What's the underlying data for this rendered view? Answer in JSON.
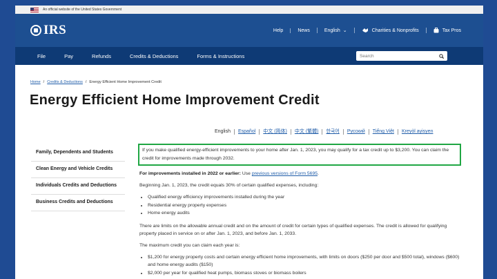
{
  "gov_banner": {
    "text": "An official website of the United States Government"
  },
  "header": {
    "logo": "IRS",
    "links": [
      {
        "label": "Help"
      },
      {
        "label": "News"
      },
      {
        "label": "English"
      },
      {
        "label": "Charities & Nonprofits"
      },
      {
        "label": "Tax Pros"
      }
    ]
  },
  "nav": {
    "items": [
      "File",
      "Pay",
      "Refunds",
      "Credits & Deductions",
      "Forms & Instructions"
    ],
    "search_placeholder": "Search"
  },
  "breadcrumb": [
    "Home",
    "Credits & Deductions",
    "Energy Efficient Home Improvement Credit"
  ],
  "page_title": "Energy Efficient Home Improvement Credit",
  "languages": [
    "English",
    "Español",
    "中文 (简体)",
    "中文 (繁體)",
    "한국어",
    "Русский",
    "Tiếng Việt",
    "Kreyòl ayisyen"
  ],
  "sidebar": {
    "items": [
      "Family, Dependents and Students",
      "Clean Energy and Vehicle Credits",
      "Individuals Credits and Deductions",
      "Business Credits and Deductions"
    ]
  },
  "content": {
    "highlight": "If you make qualified energy-efficient improvements to your home after Jan. 1, 2023, you may qualify for a tax credit up to $3,200. You can claim the credit for improvements made through 2032.",
    "prior_bold": "For improvements installed in 2022 or earlier:",
    "prior_text": " Use ",
    "prior_link": "previous versions of Form 5695",
    "prior_end": ".",
    "intro": "Beginning Jan. 1, 2023, the credit equals 30% of certain qualified expenses, including:",
    "list1": [
      "Qualified energy efficiency improvements installed during the year",
      "Residential energy property expenses",
      "Home energy audits"
    ],
    "limits": "There are limits on the allowable annual credit and on the amount of credit for certain types of qualified expenses. The credit is allowed for qualifying property placed in service on or after Jan. 1, 2023, and before Jan. 1, 2033.",
    "max": "The maximum credit you can claim each year is:",
    "list2": [
      "$1,200 for energy property costs and certain energy efficient home improvements, with limits on doors ($250 per door and $500 total), windows ($600) and home energy audits ($150)",
      "$2,000 per year for qualified heat pumps, biomass stoves or biomass boilers"
    ]
  }
}
